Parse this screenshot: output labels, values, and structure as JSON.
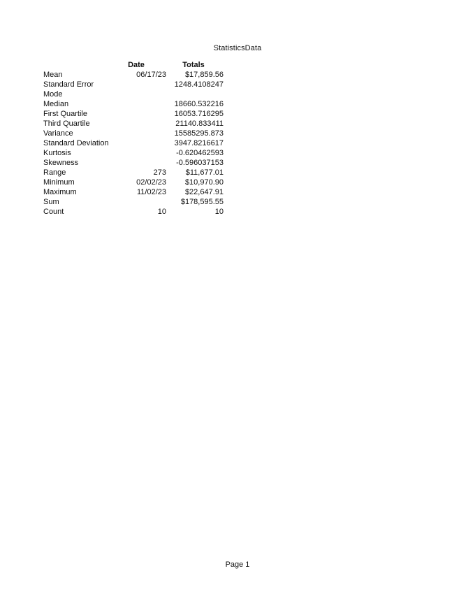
{
  "header": {
    "title": "StatisticsData"
  },
  "footer": {
    "page_label": "Page 1"
  },
  "table": {
    "name": "descriptive-statistics",
    "columns": [
      {
        "key": "label",
        "header": ""
      },
      {
        "key": "date",
        "header": "Date"
      },
      {
        "key": "totals",
        "header": "Totals"
      }
    ],
    "rows": [
      {
        "label": "Mean",
        "date": "06/17/23",
        "totals": "$17,859.56"
      },
      {
        "label": "Standard Error",
        "date": "",
        "totals": "1248.4108247"
      },
      {
        "label": "Mode",
        "date": "",
        "totals": ""
      },
      {
        "label": "Median",
        "date": "",
        "totals": "18660.532216"
      },
      {
        "label": "First Quartile",
        "date": "",
        "totals": "16053.716295"
      },
      {
        "label": "Third Quartile",
        "date": "",
        "totals": "21140.833411"
      },
      {
        "label": "Variance",
        "date": "",
        "totals": "15585295.873"
      },
      {
        "label": "Standard Deviation",
        "date": "",
        "totals": "3947.8216617"
      },
      {
        "label": "Kurtosis",
        "date": "",
        "totals": "-0.620462593"
      },
      {
        "label": "Skewness",
        "date": "",
        "totals": "-0.596037153"
      },
      {
        "label": "Range",
        "date": "273",
        "totals": "$11,677.01"
      },
      {
        "label": "Minimum",
        "date": "02/02/23",
        "totals": "$10,970.90"
      },
      {
        "label": "Maximum",
        "date": "11/02/23",
        "totals": "$22,647.91"
      },
      {
        "label": "Sum",
        "date": "",
        "totals": "$178,595.55"
      },
      {
        "label": "Count",
        "date": "10",
        "totals": "10"
      }
    ]
  }
}
